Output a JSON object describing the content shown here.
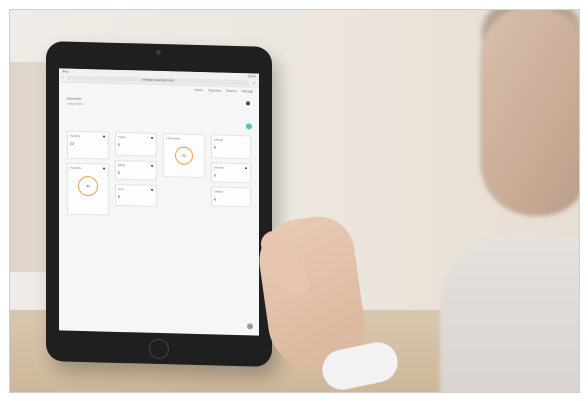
{
  "screen": {
    "status": {
      "left": "iPad",
      "right": "100%"
    },
    "url": "webapp.openhab.local",
    "tabs": [
      "Home",
      "Overview",
      "Rooms",
      "Settings"
    ],
    "page_title": "Overview",
    "page_subtitle": "Living Room",
    "cards": [
      {
        "title": "Heating",
        "value": "22"
      },
      {
        "title": "Lights",
        "value": "0"
      },
      {
        "title": "Thermostat",
        "value": "21"
      },
      {
        "title": "Energy",
        "value": "8"
      },
      {
        "title": "Humidity",
        "value": "41"
      },
      {
        "title": "Blinds",
        "value": "0"
      },
      {
        "title": "Door",
        "value": "6"
      },
      {
        "title": "Window",
        "value": "0"
      },
      {
        "title": "Sensor",
        "value": "6"
      }
    ]
  },
  "colors": {
    "accent_ring": "#f2a33a",
    "active_tab": "#d4472b",
    "toggle": "#56c3b5"
  }
}
